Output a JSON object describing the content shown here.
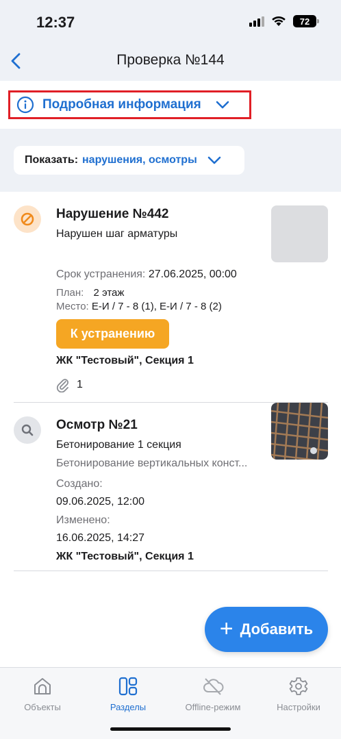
{
  "status_bar": {
    "time": "12:37",
    "battery": "72"
  },
  "header": {
    "title": "Проверка №144"
  },
  "info": {
    "label": "Подробная информация"
  },
  "filter": {
    "label": "Показать:",
    "value": "нарушения, осмотры"
  },
  "items": [
    {
      "type": "violation",
      "icon": "prohibited-icon",
      "title": "Нарушение №442",
      "subtitle": "Нарушен шаг арматуры",
      "deadline_label": "Срок устранения:",
      "deadline_value": "27.06.2025, 00:00",
      "plan_label": "План:",
      "plan_value": "2 этаж",
      "place_label": "Место:",
      "place_value": "Е-И / 7 - 8 (1), Е-И / 7 - 8 (2)",
      "action": "К устранению",
      "project": "ЖК \"Тестовый\", Секция 1",
      "attachments": "1"
    },
    {
      "type": "inspection",
      "icon": "search-icon",
      "title": "Осмотр №21",
      "subtitle": "Бетонирование 1 секция",
      "description": "Бетонирование вертикальных конст...",
      "created_label": "Создано:",
      "created_value": "09.06.2025, 12:00",
      "changed_label": "Изменено:",
      "changed_value": "16.06.2025, 14:27",
      "project": "ЖК \"Тестовый\", Секция 1"
    }
  ],
  "fab": {
    "label": "Добавить"
  },
  "tabs": [
    {
      "label": "Объекты",
      "icon": "home-icon",
      "active": false
    },
    {
      "label": "Разделы",
      "icon": "grid-icon",
      "active": true
    },
    {
      "label": "Offline-режим",
      "icon": "cloud-off-icon",
      "active": false
    },
    {
      "label": "Настройки",
      "icon": "gear-icon",
      "active": false
    }
  ],
  "colors": {
    "accent": "#1f6fd0",
    "fab": "#2b84ea",
    "action": "#f5a623",
    "highlight": "#e01f26"
  }
}
